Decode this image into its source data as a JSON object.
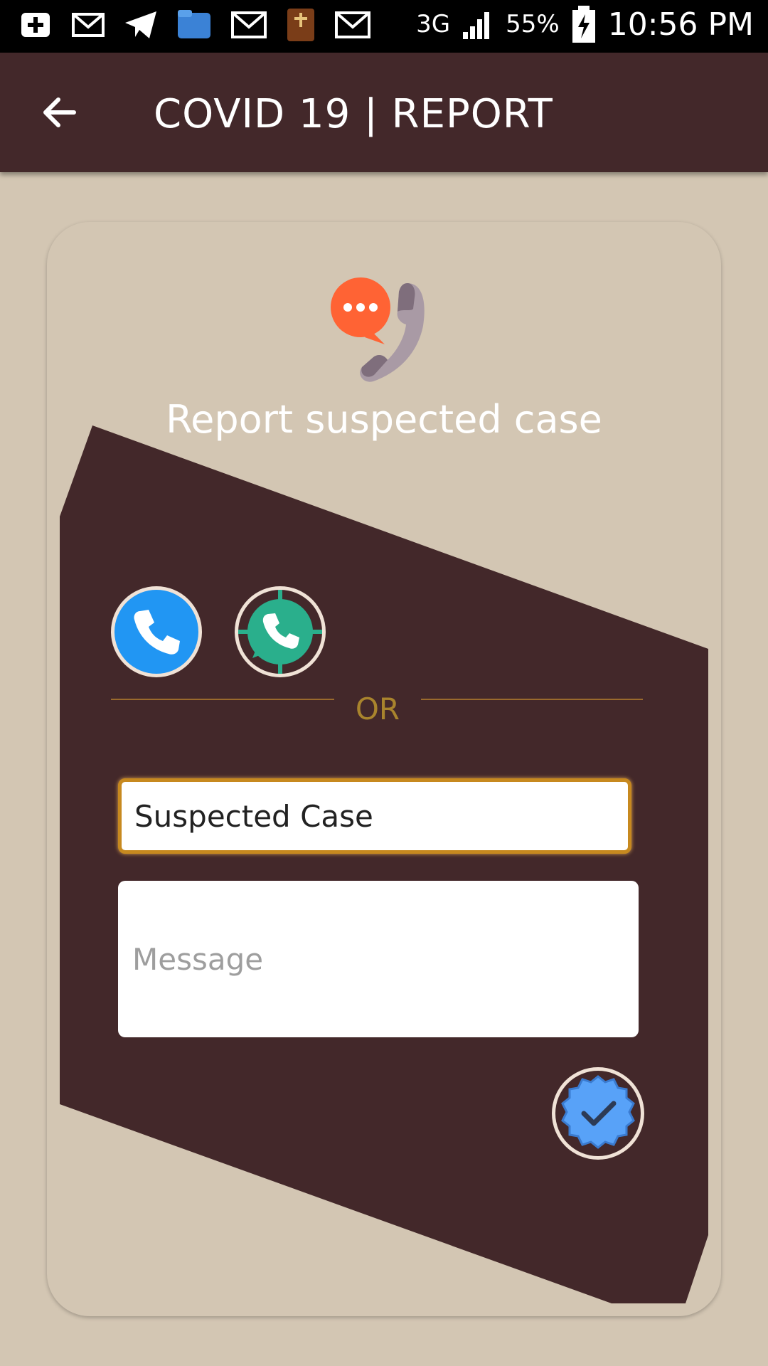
{
  "status": {
    "network": "3G",
    "battery": "55%",
    "time": "10:56 PM"
  },
  "header": {
    "title": "COVID 19 | REPORT"
  },
  "card": {
    "title": "Report suspected case",
    "or_text": "OR",
    "subject_value": "Suspected Case",
    "message_placeholder": "Message"
  },
  "icons": {
    "back": "arrow-left-icon",
    "hero": "chat-phone-icon",
    "call": "phone-icon",
    "whatsapp": "whatsapp-icon",
    "submit": "check-badge-icon"
  },
  "colors": {
    "app_bar": "#43282a",
    "background": "#d3c6b3",
    "call_blue": "#2196f3",
    "whatsapp_green": "#2aaf8c",
    "accent_gold": "#c7891f"
  }
}
